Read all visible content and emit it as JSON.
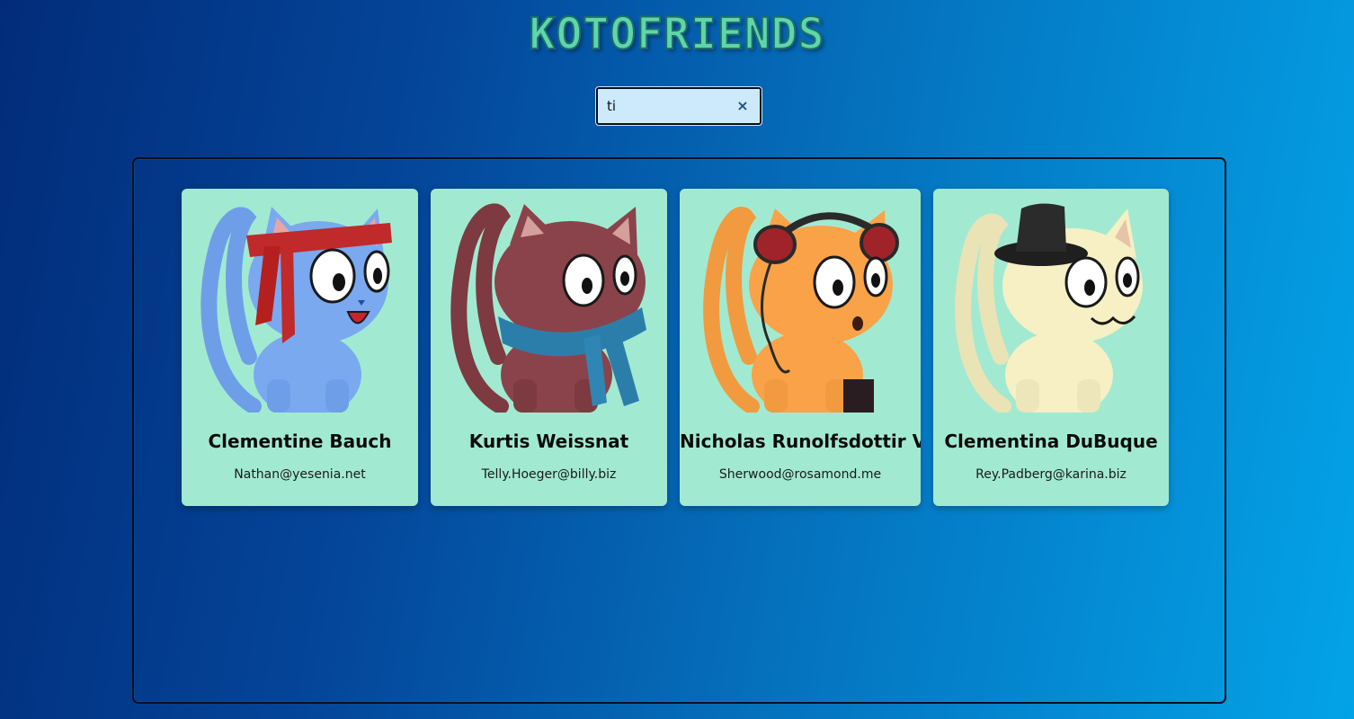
{
  "app": {
    "title": "KOTOFRIENDS"
  },
  "search": {
    "value": "ti",
    "clear_icon": "×"
  },
  "cards": [
    {
      "name": "Clementine Bauch",
      "email": "Nathan@yesenia.net",
      "avatar": "blue-cat-with-red-headband",
      "color": "#7aa9f0"
    },
    {
      "name": "Kurtis Weissnat",
      "email": "Telly.Hoeger@billy.biz",
      "avatar": "maroon-cat-with-blue-scarf",
      "color": "#8a434a"
    },
    {
      "name": "Nicholas Runolfsdottir V",
      "email": "Sherwood@rosamond.me",
      "avatar": "orange-cat-with-headphones",
      "color": "#f9a247"
    },
    {
      "name": "Clementina DuBuque",
      "email": "Rey.Padberg@karina.biz",
      "avatar": "cream-cat-with-top-hat",
      "color": "#f6f0c4"
    }
  ],
  "theme": {
    "card_bg": "#a1ead1",
    "title_color": "#5fd6a9",
    "search_bg": "#cdeafd"
  }
}
